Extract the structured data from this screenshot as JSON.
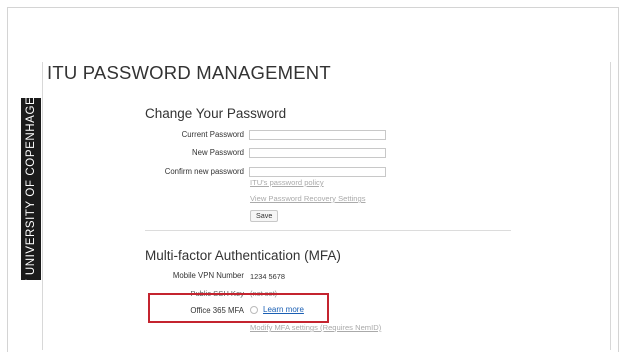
{
  "header": {
    "title": "ITU PASSWORD MANAGEMENT"
  },
  "side_banner": {
    "text": "IT UNIVERSITY OF COPENHAGEN"
  },
  "change_password": {
    "title": "Change Your Password",
    "current_label": "Current Password",
    "new_label": "New Password",
    "confirm_label": "Confirm new password",
    "policy_link": "ITU's password policy",
    "recovery_link": "View Password Recovery Settings",
    "save_label": "Save"
  },
  "mfa": {
    "title": "Multi-factor Authentication (MFA)",
    "vpn_label": "Mobile VPN Number",
    "vpn_value": "1234 5678",
    "ssh_label": "Public SSH Key",
    "ssh_value": "(not set)",
    "office_label": "Office 365 MFA",
    "learn_more": "Learn more",
    "modify_link": "Modify MFA settings (Requires NemID)"
  },
  "colors": {
    "highlight": "#c4242f",
    "link": "#1a5fb4",
    "banner": "#1b1b1b"
  }
}
